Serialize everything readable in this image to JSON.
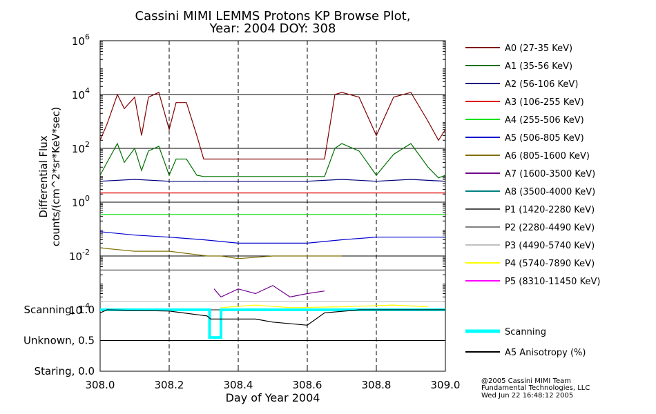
{
  "chart_data": [
    {
      "type": "line",
      "title": "Cassini MIMI LEMMS Protons KP Browse Plot,",
      "subtitle": "Year: 2004 DOY: 308",
      "xlabel": "Day of Year 2004",
      "ylabel_line1": "Differential Flux",
      "ylabel_line2": "counts/(cm^2*sr*KeV*sec)",
      "x_ticks": [
        "308.0",
        "308.2",
        "308.4",
        "308.6",
        "308.8",
        "309.0"
      ],
      "y_ticks": [
        {
          "base": "10",
          "exp": "6"
        },
        {
          "base": "10",
          "exp": "4"
        },
        {
          "base": "10",
          "exp": "2"
        },
        {
          "base": "10",
          "exp": "0"
        },
        {
          "base": "10",
          "exp": "-2"
        },
        {
          "base": "10",
          "exp": "-4"
        }
      ],
      "yscale": "log",
      "xlim": [
        308.0,
        309.0
      ],
      "ylim": [
        0.0001,
        1000000
      ],
      "grid": true,
      "legend_position": "right",
      "series": [
        {
          "name": "A0 (27-35 KeV)",
          "color": "#800000",
          "x": [
            308.0,
            308.02,
            308.05,
            308.07,
            308.1,
            308.12,
            308.14,
            308.17,
            308.2,
            308.22,
            308.25,
            308.28,
            308.3,
            308.4,
            308.5,
            308.6,
            308.65,
            308.68,
            308.7,
            308.75,
            308.8,
            308.85,
            308.9,
            308.95,
            308.98,
            309.0
          ],
          "y": [
            200,
            800,
            10000,
            3000,
            8000,
            300,
            8000,
            12000,
            500,
            5000,
            5000,
            300,
            40,
            40,
            40,
            40,
            40,
            10000,
            12000,
            8000,
            300,
            8000,
            12000,
            1000,
            200,
            500
          ]
        },
        {
          "name": "A1 (35-56 KeV)",
          "color": "#007000",
          "x": [
            308.0,
            308.02,
            308.05,
            308.07,
            308.1,
            308.12,
            308.14,
            308.17,
            308.2,
            308.22,
            308.25,
            308.28,
            308.3,
            308.4,
            308.5,
            308.6,
            308.65,
            308.68,
            308.7,
            308.75,
            308.8,
            308.85,
            308.9,
            308.95,
            308.98,
            309.0
          ],
          "y": [
            10,
            30,
            150,
            30,
            100,
            15,
            80,
            120,
            10,
            40,
            40,
            10,
            9,
            9,
            9,
            9,
            9,
            100,
            150,
            80,
            10,
            60,
            150,
            20,
            8,
            10
          ]
        },
        {
          "name": "A2 (56-106 KeV)",
          "color": "#000080",
          "x": [
            308.0,
            308.1,
            308.2,
            308.3,
            308.4,
            308.5,
            308.6,
            308.7,
            308.8,
            308.9,
            309.0
          ],
          "y": [
            6,
            7,
            6,
            6,
            6,
            6,
            6,
            7,
            6,
            7,
            6
          ]
        },
        {
          "name": "A3 (106-255 KeV)",
          "color": "#e00000",
          "x": [
            308.0,
            308.25,
            308.5,
            308.75,
            309.0
          ],
          "y": [
            2.2,
            2.2,
            2.2,
            2.2,
            2.2
          ]
        },
        {
          "name": "A4 (255-506 KeV)",
          "color": "#00e000",
          "x": [
            308.0,
            308.25,
            308.5,
            308.75,
            309.0
          ],
          "y": [
            0.35,
            0.35,
            0.35,
            0.35,
            0.35
          ]
        },
        {
          "name": "A5 (506-805 KeV)",
          "color": "#0000d0",
          "x": [
            308.0,
            308.1,
            308.2,
            308.3,
            308.4,
            308.5,
            308.6,
            308.7,
            308.8,
            308.9,
            309.0
          ],
          "y": [
            0.08,
            0.06,
            0.05,
            0.04,
            0.03,
            0.03,
            0.03,
            0.04,
            0.05,
            0.05,
            0.05
          ]
        },
        {
          "name": "A6 (805-1600 KeV)",
          "color": "#807000",
          "x": [
            308.0,
            308.1,
            308.2,
            308.31,
            308.35,
            308.4,
            308.5,
            308.6,
            308.65,
            308.7
          ],
          "y": [
            0.02,
            0.015,
            0.015,
            0.01,
            0.01,
            0.008,
            0.01,
            0.01,
            0.01,
            0.01
          ]
        },
        {
          "name": "A7 (1600-3500 KeV)",
          "color": "#700090",
          "x": [
            308.33,
            308.35,
            308.4,
            308.45,
            308.5,
            308.55,
            308.6,
            308.65
          ],
          "y": [
            0.0006,
            0.0003,
            0.0006,
            0.0004,
            0.0008,
            0.0003,
            0.0004,
            0.0005
          ]
        },
        {
          "name": "A8 (3500-4000 KeV)",
          "color": "#008080",
          "x": [],
          "y": []
        },
        {
          "name": "P1 (1420-2280 KeV)",
          "color": "#505050",
          "x": [
            308.0,
            308.1,
            308.2,
            308.3,
            308.4,
            308.5,
            308.6,
            308.7,
            308.8,
            308.9,
            309.0
          ],
          "y": [
            0.003,
            0.003,
            0.003,
            0.003,
            0.003,
            0.003,
            0.003,
            0.003,
            0.003,
            0.003,
            0.003
          ]
        },
        {
          "name": "P2 (2280-4490 KeV)",
          "color": "#808080",
          "x": [],
          "y": []
        },
        {
          "name": "P3 (4490-5740 KeV)",
          "color": "#c0c0c0",
          "x": [
            308.0,
            308.25,
            308.5,
            308.75,
            309.0
          ],
          "y": [
            0.0002,
            0.0002,
            0.0002,
            0.0002,
            0.0002
          ]
        },
        {
          "name": "P4 (5740-7890 KeV)",
          "color": "#ffff00",
          "x": [
            308.35,
            308.45,
            308.55,
            308.7,
            308.85,
            308.95
          ],
          "y": [
            0.00012,
            0.00015,
            0.00012,
            0.00013,
            0.00015,
            0.00013
          ]
        },
        {
          "name": "P5 (8310-11450 KeV)",
          "color": "#ff00ff",
          "x": [],
          "y": []
        }
      ]
    },
    {
      "type": "line",
      "xlabel": "Day of Year 2004",
      "y_ticks": [
        "Scanning, 1.0",
        "Unknown, 0.5",
        "Staring, 0.0"
      ],
      "ylim": [
        0.0,
        1.0
      ],
      "xlim": [
        308.0,
        309.0
      ],
      "series": [
        {
          "name": "Scanning",
          "color": "#00ffff",
          "x": [
            308.0,
            308.317,
            308.317,
            308.35,
            308.35,
            309.0
          ],
          "y": [
            1.0,
            1.0,
            0.55,
            0.55,
            1.0,
            1.0
          ]
        },
        {
          "name": "A5 Anisotropy (%)",
          "color": "#000000",
          "x": [
            308.0,
            308.02,
            308.2,
            308.31,
            308.32,
            308.36,
            308.45,
            308.5,
            308.6,
            308.65,
            308.75,
            309.0
          ],
          "y": [
            0.95,
            1.0,
            0.98,
            0.9,
            0.85,
            0.85,
            0.85,
            0.8,
            0.75,
            0.95,
            1.0,
            1.0
          ]
        }
      ]
    }
  ],
  "footer": {
    "credit": "@2005 Cassini MIMI Team",
    "company": "Fundamental Technologies, LLC",
    "timestamp": "Wed Jun 22 16:48:12 2005"
  }
}
